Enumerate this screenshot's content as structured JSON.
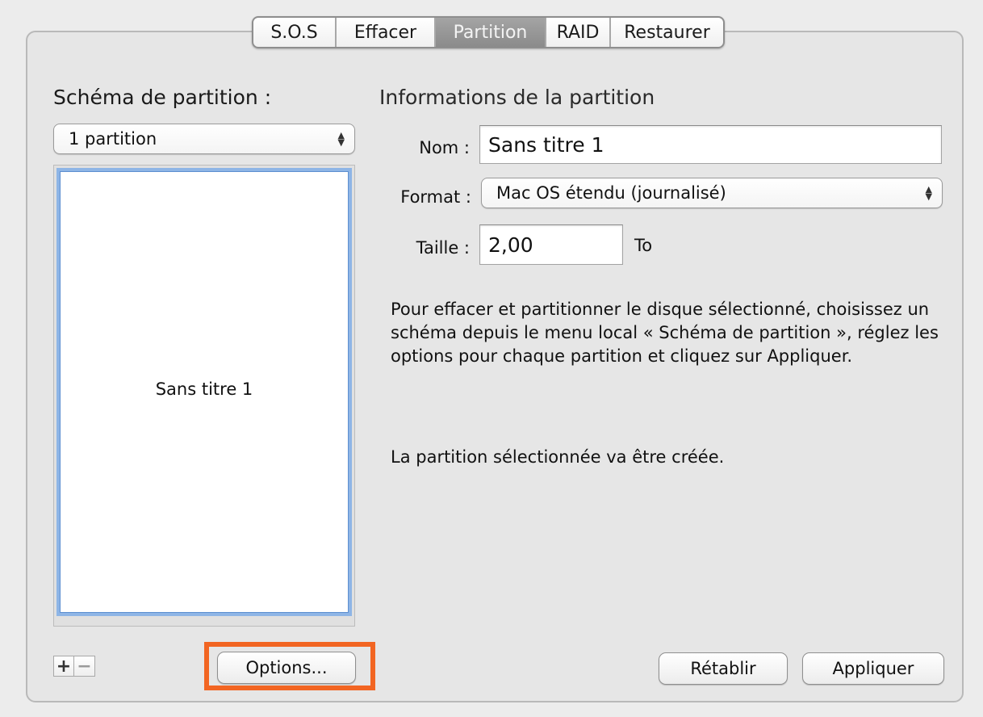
{
  "tabs": [
    {
      "label": "S.O.S",
      "active": false
    },
    {
      "label": "Effacer",
      "active": false
    },
    {
      "label": "Partition",
      "active": true
    },
    {
      "label": "RAID",
      "active": false
    },
    {
      "label": "Restaurer",
      "active": false
    }
  ],
  "left": {
    "heading": "Schéma de partition :",
    "scheme_select": "1 partition",
    "partitions": [
      {
        "label": "Sans titre 1"
      }
    ],
    "add_label": "+",
    "remove_label": "−",
    "options_label": "Options..."
  },
  "right": {
    "heading": "Informations de la partition",
    "name_label": "Nom :",
    "name_value": "Sans titre 1",
    "format_label": "Format :",
    "format_value": "Mac OS étendu (journalisé)",
    "size_label": "Taille :",
    "size_value": "2,00",
    "size_unit": "To",
    "info_text": "Pour effacer et partitionner le disque sélectionné, choisissez un schéma depuis le menu local « Schéma de partition », réglez les options pour chaque partition et cliquez sur Appliquer.",
    "status_text": "La partition sélectionnée va être créée.",
    "revert_label": "Rétablir",
    "apply_label": "Appliquer"
  },
  "colors": {
    "highlight": "#f26522",
    "selection": "#8eb5e6",
    "active_tab": "#949494"
  },
  "icons": {
    "select_arrows": "up-down-chevron-icon"
  }
}
